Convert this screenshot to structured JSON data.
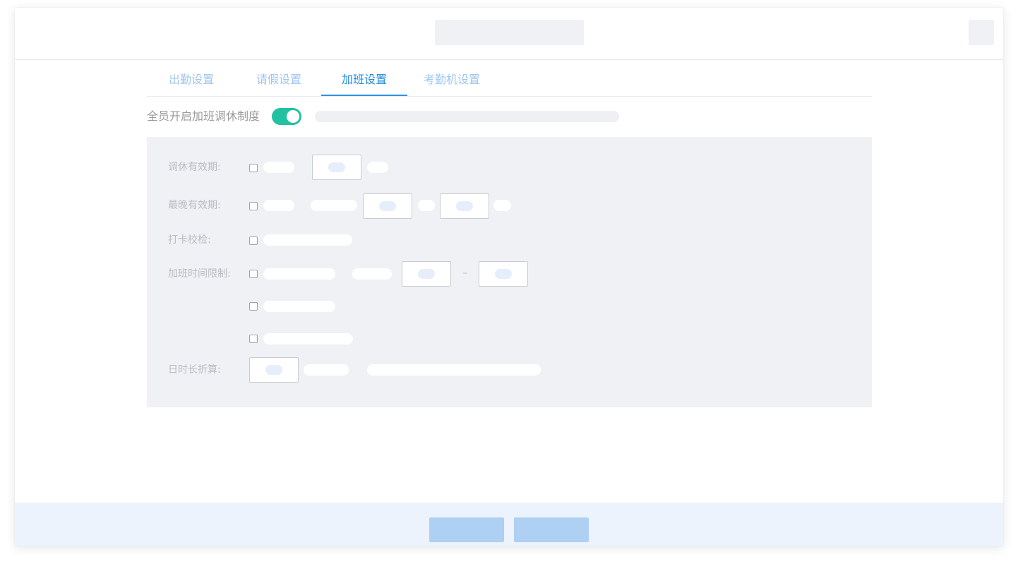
{
  "tabs": [
    {
      "label": "出勤设置",
      "active": false
    },
    {
      "label": "请假设置",
      "active": false
    },
    {
      "label": "加班设置",
      "active": true
    },
    {
      "label": "考勤机设置",
      "active": false
    }
  ],
  "overtime": {
    "toggle_label": "全员开启加班调休制度",
    "toggle_on": true
  },
  "form": {
    "rows": [
      {
        "label": "调休有效期:"
      },
      {
        "label": "最晚有效期:"
      },
      {
        "label": "打卡校检:"
      },
      {
        "label": "加班时间限制:",
        "range_separator": "–"
      },
      {
        "label": "日时长折算:"
      }
    ]
  },
  "colors": {
    "accent": "#1f8ae0",
    "toggle_on": "#21c1a2",
    "panel_bg": "#f0f1f5",
    "footer_bg": "#ecf3fc",
    "button_placeholder": "#aed0f3"
  }
}
